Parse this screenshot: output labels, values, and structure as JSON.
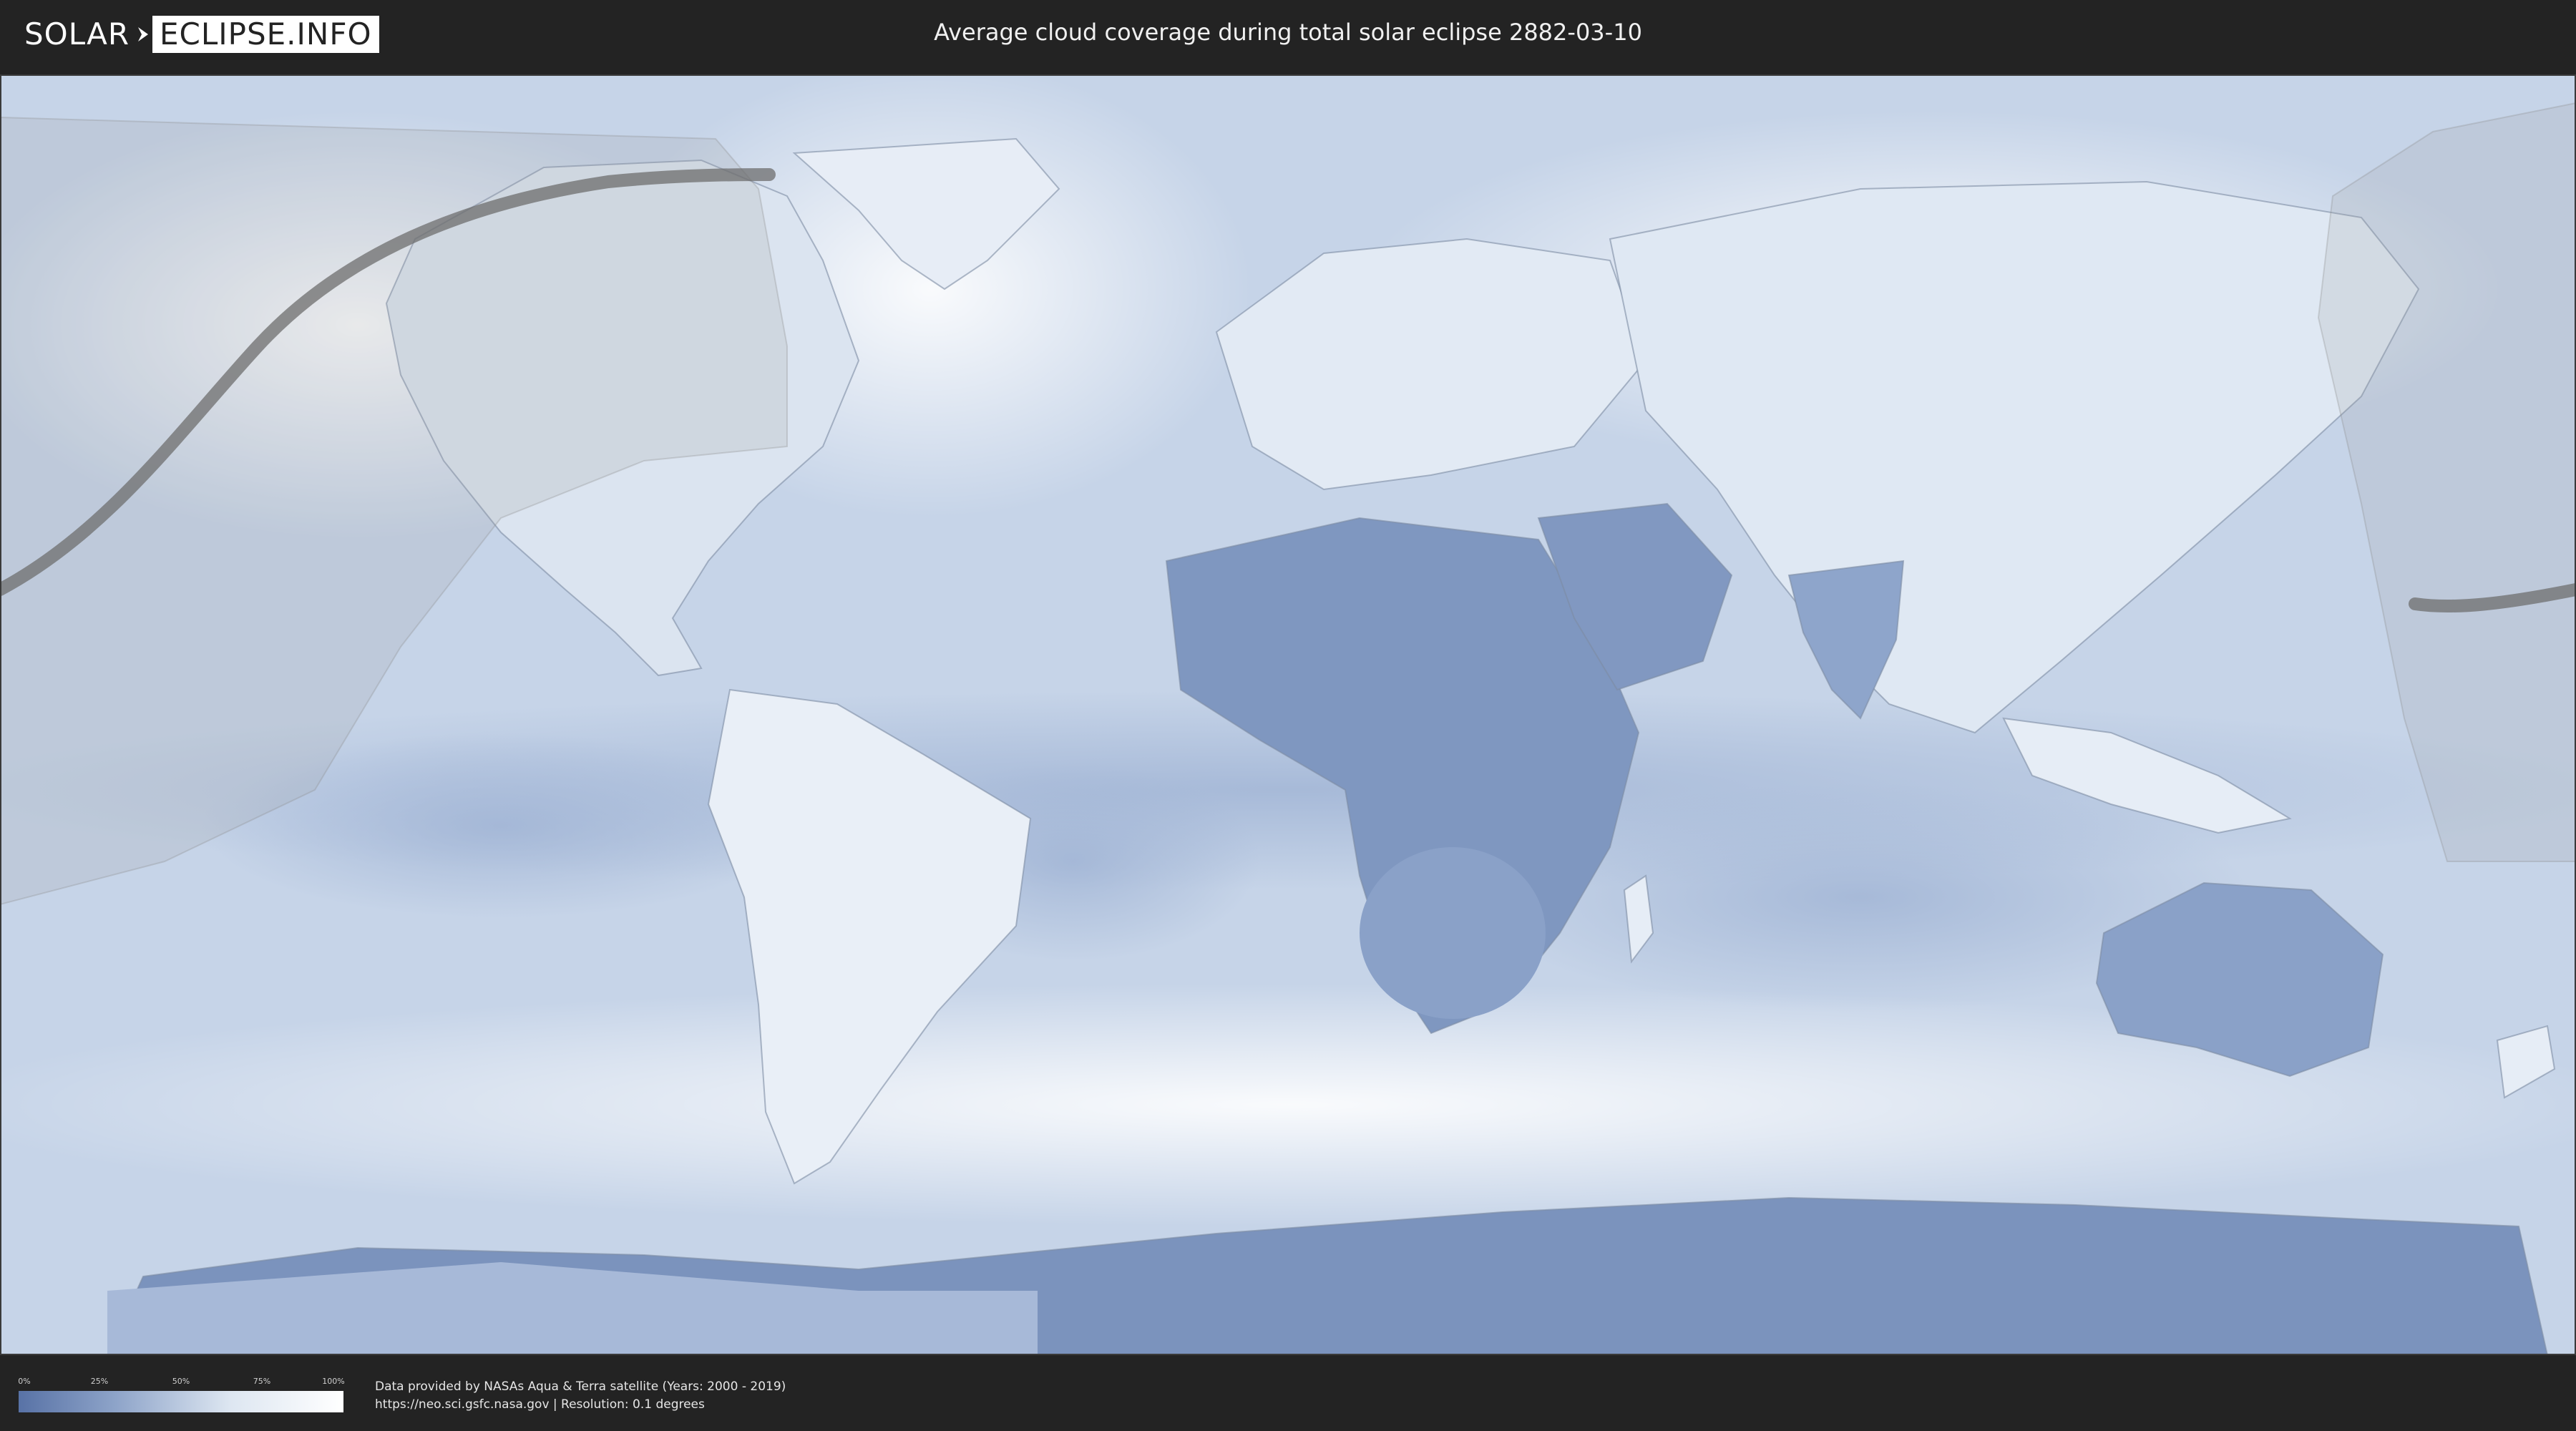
{
  "header": {
    "logo_left": "SOLAR",
    "logo_right": "ECLIPSE.INFO",
    "title": "Average cloud coverage during total solar eclipse 2882-03-10"
  },
  "map": {
    "colors": {
      "clear_sky": "#5872a6",
      "full_cloud": "#ffffff",
      "eclipse_path": "#6e6e6e",
      "visibility_overlay": "#9a9a9a"
    },
    "features": [
      "cloud-coverage-raster",
      "continent-outlines",
      "eclipse-visibility-overlay",
      "eclipse-totality-path"
    ]
  },
  "legend": {
    "ticks": [
      "0%",
      "25%",
      "50%",
      "75%",
      "100%"
    ],
    "tick_values": [
      0,
      25,
      50,
      75,
      100
    ]
  },
  "footer": {
    "credit_line1": "Data provided by NASAs Aqua & Terra satellite (Years: 2000 - 2019)",
    "credit_line2": "https://neo.sci.gsfc.nasa.gov | Resolution: 0.1 degrees"
  }
}
